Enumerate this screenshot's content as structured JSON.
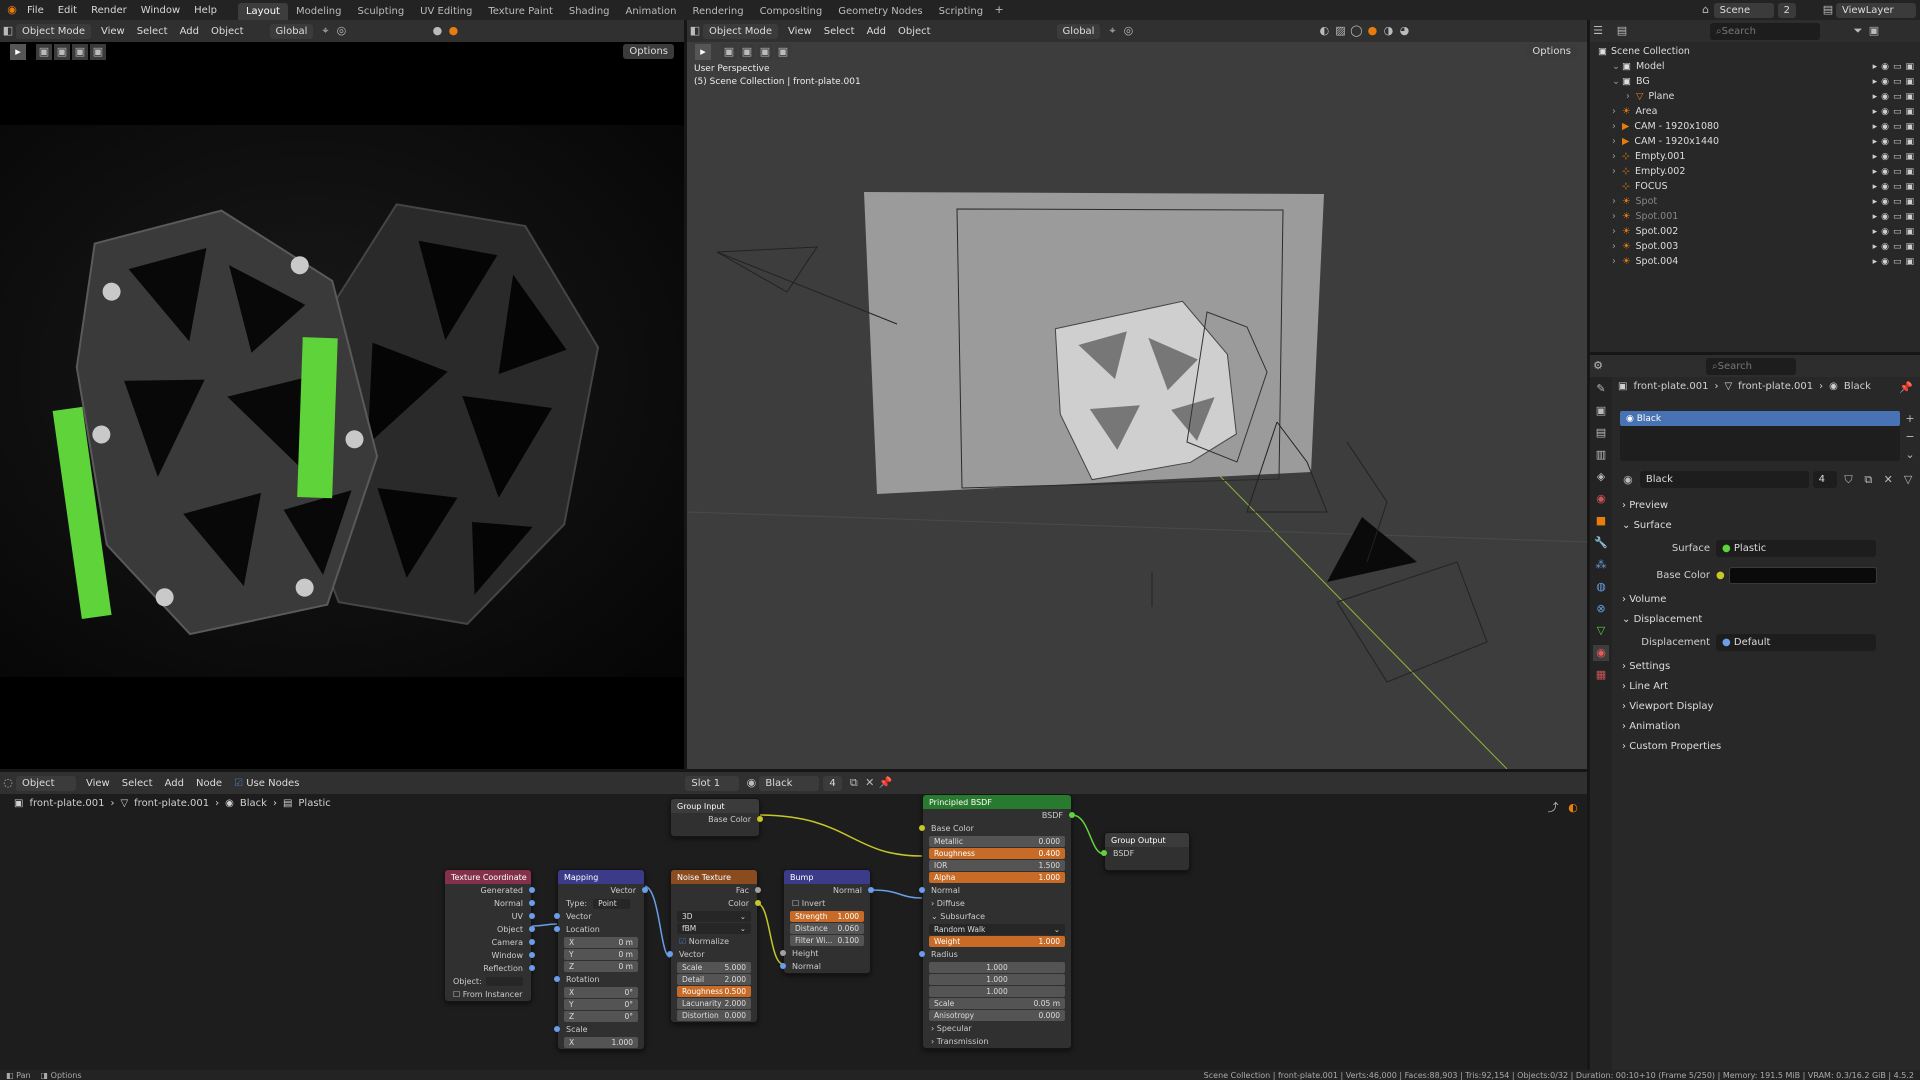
{
  "app_menu": [
    "File",
    "Edit",
    "Render",
    "Window",
    "Help"
  ],
  "workspaces": [
    "Layout",
    "Modeling",
    "Sculpting",
    "UV Editing",
    "Texture Paint",
    "Shading",
    "Animation",
    "Rendering",
    "Compositing",
    "Geometry Nodes",
    "Scripting"
  ],
  "active_workspace": "Layout",
  "scene": {
    "name": "Scene",
    "layer": "ViewLayer",
    "number": "2"
  },
  "left_view": {
    "mode": "Object Mode",
    "menus": [
      "View",
      "Select",
      "Add",
      "Object"
    ],
    "orientation": "Global",
    "options": "Options"
  },
  "right_view": {
    "mode": "Object Mode",
    "menus": [
      "View",
      "Select",
      "Add",
      "Object"
    ],
    "orientation": "Global",
    "options": "Options",
    "overlay_line1": "User Perspective",
    "overlay_line2": "(5) Scene Collection | front-plate.001"
  },
  "outliner": {
    "search": "Search",
    "root": "Scene Collection",
    "items": [
      {
        "name": "Model",
        "indent": 1,
        "expand": "v",
        "icon": "collection-icon"
      },
      {
        "name": "BG",
        "indent": 1,
        "expand": "v",
        "icon": "collection-icon"
      },
      {
        "name": "Plane",
        "indent": 2,
        "expand": ">",
        "icon": "mesh-icon"
      },
      {
        "name": "Area",
        "indent": 1,
        "expand": ">",
        "icon": "light-icon"
      },
      {
        "name": "CAM - 1920x1080",
        "indent": 1,
        "expand": ">",
        "icon": "camera-icon"
      },
      {
        "name": "CAM - 1920x1440",
        "indent": 1,
        "expand": ">",
        "icon": "camera-icon"
      },
      {
        "name": "Empty.001",
        "indent": 1,
        "expand": ">",
        "icon": "empty-icon"
      },
      {
        "name": "Empty.002",
        "indent": 1,
        "expand": ">",
        "icon": "empty-icon"
      },
      {
        "name": "FOCUS",
        "indent": 1,
        "expand": "",
        "icon": "empty-icon"
      },
      {
        "name": "Spot",
        "indent": 1,
        "expand": ">",
        "icon": "light-icon"
      },
      {
        "name": "Spot.001",
        "indent": 1,
        "expand": ">",
        "icon": "light-icon"
      },
      {
        "name": "Spot.002",
        "indent": 1,
        "expand": ">",
        "icon": "light-icon"
      },
      {
        "name": "Spot.003",
        "indent": 1,
        "expand": ">",
        "icon": "light-icon"
      },
      {
        "name": "Spot.004",
        "indent": 1,
        "expand": ">",
        "icon": "light-icon"
      }
    ]
  },
  "properties": {
    "search": "Search",
    "breadcrumb": [
      "front-plate.001",
      "front-plate.001",
      "Black"
    ],
    "slot": "Black",
    "material_name": "Black",
    "users": "4",
    "sections": {
      "preview": "Preview",
      "surface": "Surface",
      "volume": "Volume",
      "displacement": "Displacement",
      "settings": "Settings",
      "line_art": "Line Art",
      "viewport_display": "Viewport Display",
      "animation": "Animation",
      "custom_properties": "Custom Properties"
    },
    "surface_label": "Surface",
    "surface_value": "Plastic",
    "base_color_label": "Base Color",
    "base_color": "#0a0a0a",
    "displacement_label": "Displacement",
    "displacement_value": "Default"
  },
  "node_editor": {
    "mode": "Object",
    "menus": [
      "View",
      "Select",
      "Add",
      "Node"
    ],
    "use_nodes": "Use Nodes",
    "slot": "Slot 1",
    "material": "Black",
    "users": "4",
    "breadcrumb": [
      "front-plate.001",
      "front-plate.001",
      "Black",
      "Plastic"
    ]
  },
  "nodes": {
    "group_input": {
      "title": "Group Input",
      "out": "Base Color"
    },
    "principled": {
      "title": "Principled BSDF",
      "out": "BSDF",
      "base_color": "Base Color",
      "metallic": [
        "Metallic",
        "0.000"
      ],
      "roughness": [
        "Roughness",
        "0.400"
      ],
      "ior": [
        "IOR",
        "1.500"
      ],
      "alpha": [
        "Alpha",
        "1.000"
      ],
      "normal": "Normal",
      "diffuse": "Diffuse",
      "subsurface": "Subsurface",
      "method": "Random Walk",
      "weight": [
        "Weight",
        "1.000"
      ],
      "radius": "Radius",
      "r1": "1.000",
      "r2": "1.000",
      "r3": "1.000",
      "scale": [
        "Scale",
        "0.05 m"
      ],
      "aniso": [
        "Anisotropy",
        "0.000"
      ],
      "specular": "Specular",
      "transmission": "Transmission"
    },
    "group_output": {
      "title": "Group Output",
      "in": "BSDF"
    },
    "texcoord": {
      "title": "Texture Coordinate",
      "outs": [
        "Generated",
        "Normal",
        "UV",
        "Object",
        "Camera",
        "Window",
        "Reflection"
      ],
      "object": "Object:",
      "from_instancer": "From Instancer"
    },
    "mapping": {
      "title": "Mapping",
      "out": "Vector",
      "type_label": "Type:",
      "type": "Point",
      "vector": "Vector",
      "location": "Location",
      "loc": [
        [
          "X",
          "0 m"
        ],
        [
          "Y",
          "0 m"
        ],
        [
          "Z",
          "0 m"
        ]
      ],
      "rotation": "Rotation",
      "rot": [
        [
          "X",
          "0°"
        ],
        [
          "Y",
          "0°"
        ],
        [
          "Z",
          "0°"
        ]
      ],
      "scale": "Scale",
      "sc": [
        [
          "X",
          "1.000"
        ]
      ]
    },
    "noise": {
      "title": "Noise Texture",
      "outs": [
        "Fac",
        "Color"
      ],
      "dim": "3D",
      "type": "fBM",
      "normalize": "Normalize",
      "vector": "Vector",
      "fields": [
        [
          "Scale",
          "5.000"
        ],
        [
          "Detail",
          "2.000"
        ],
        [
          "Roughness",
          "0.500"
        ],
        [
          "Lacunarity",
          "2.000"
        ],
        [
          "Distortion",
          "0.000"
        ]
      ]
    },
    "bump": {
      "title": "Bump",
      "out": "Normal",
      "invert": "Invert",
      "fields": [
        [
          "Strength",
          "1.000"
        ],
        [
          "Distance",
          "0.060"
        ],
        [
          "Filter Wi...",
          "0.100"
        ]
      ],
      "height": "Height",
      "normal": "Normal"
    }
  },
  "status": {
    "left1": "Pan",
    "left2": "Options",
    "right": "Scene Collection | front-plate.001 | Verts:46,000 | Faces:88,903 | Tris:92,154 | Objects:0/32 | Duration: 00:10+10 (Frame 5/250) | Memory: 191.5 MiB | VRAM: 0.3/16.2 GiB | 4.5.2"
  }
}
